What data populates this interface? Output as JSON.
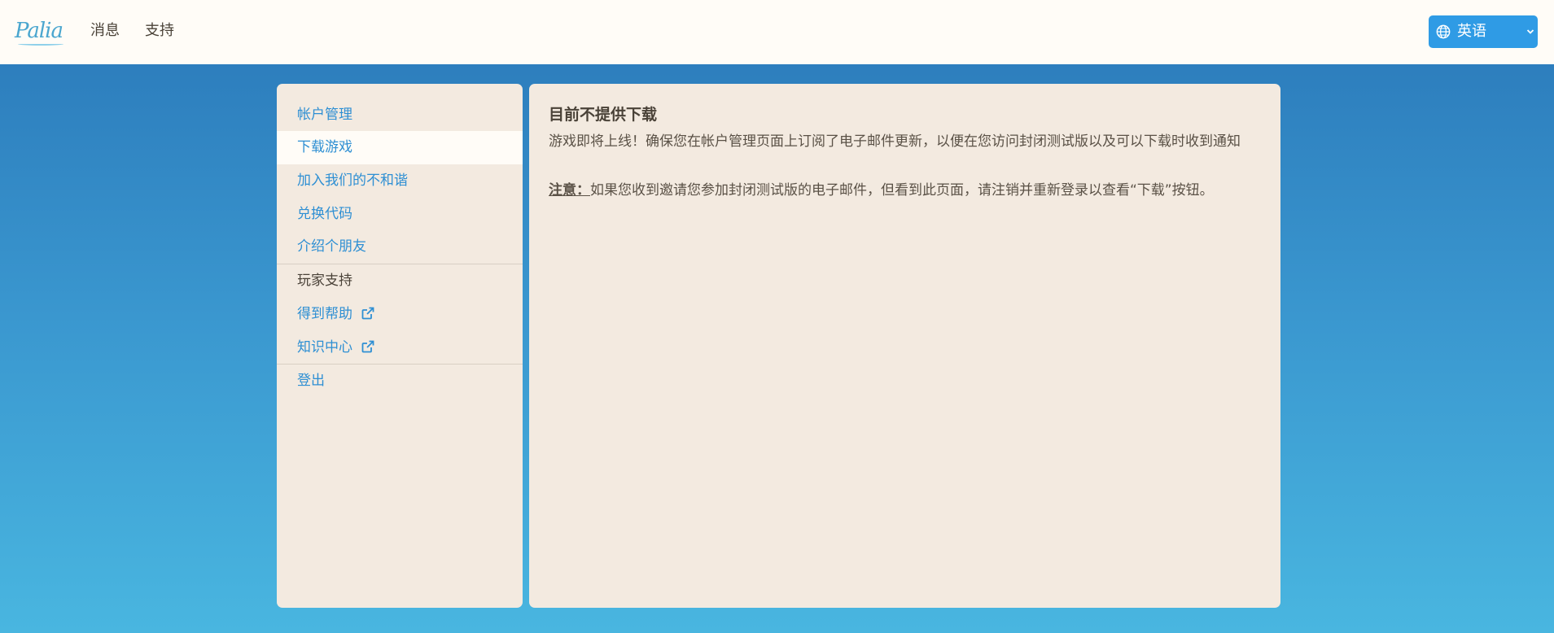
{
  "header": {
    "logo_text": "Palia",
    "nav": [
      {
        "label": "消息"
      },
      {
        "label": "支持"
      }
    ],
    "language": {
      "selected": "英语",
      "icon": "globe-icon"
    }
  },
  "sidebar": {
    "items": [
      {
        "label": "帐户管理"
      },
      {
        "label": "下载游戏"
      },
      {
        "label": "加入我们的不和谐"
      },
      {
        "label": "兑换代码"
      },
      {
        "label": "介绍个朋友"
      },
      {
        "label": "玩家支持"
      },
      {
        "label": "得到帮助"
      },
      {
        "label": "知识中心"
      },
      {
        "label": "登出"
      }
    ],
    "active_index": 1
  },
  "main": {
    "title": "目前不提供下载",
    "body": "游戏即将上线！确保您在帐户管理页面上订阅了电子邮件更新，以便在您访问封闭测试版以及可以下载时收到通知",
    "note_label": "注意：",
    "note_text": "如果您收到邀请您参加封闭测试版的电子邮件，但看到此页面，请注销并重新登录以查看“下载”按钮。"
  },
  "colors": {
    "link": "#2e8fd3",
    "panel": "#f3eae0",
    "topbar": "#fffcf7",
    "lang_button": "#2f9be5"
  }
}
